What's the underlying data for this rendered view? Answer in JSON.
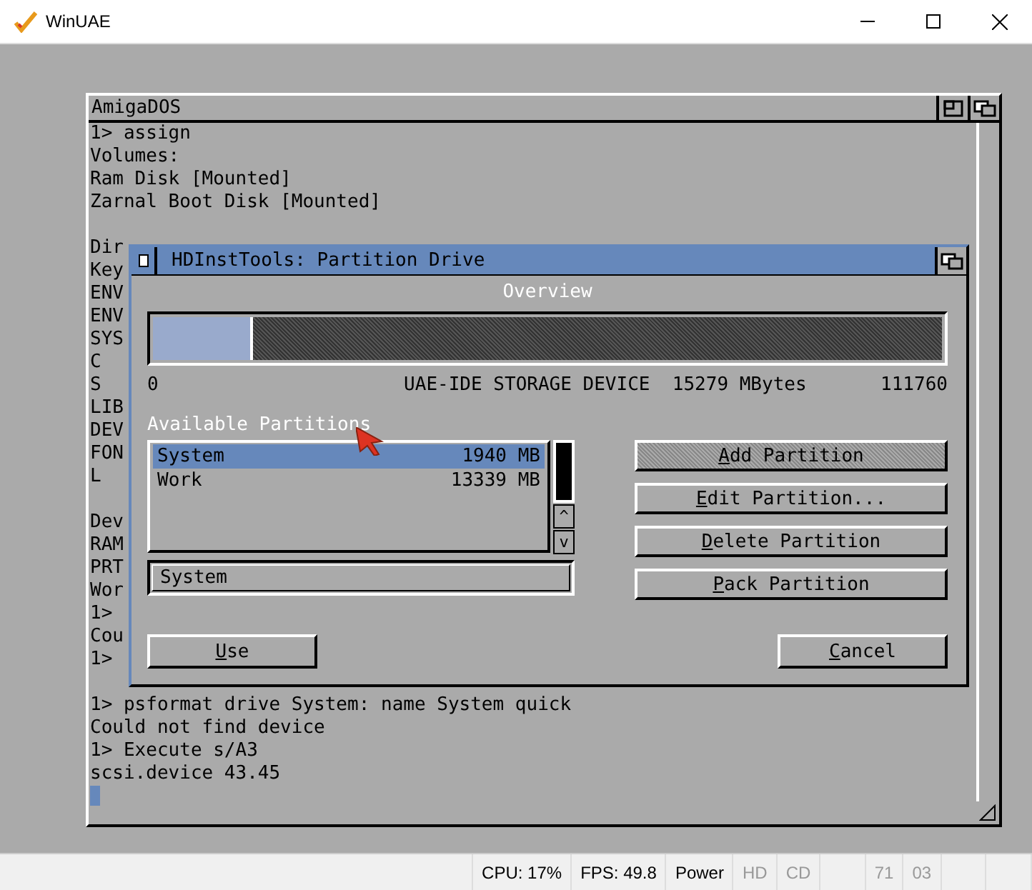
{
  "window": {
    "title": "WinUAE"
  },
  "console": {
    "title": "AmigaDOS",
    "groups": [
      [
        "1> assign",
        "Volumes:",
        "Ram Disk [Mounted]",
        "Zarnal Boot Disk [Mounted]"
      ],
      [
        "Dir",
        "Key",
        "ENV",
        "ENV",
        "SYS",
        "C",
        "S",
        "LIB",
        "DEV",
        "FON",
        "L"
      ],
      [
        "Dev",
        "RAM",
        "PRT",
        "Wor",
        "1>",
        "Cou",
        "1>"
      ],
      [
        "1> psformat drive System: name System quick",
        "Could not find device",
        "1> Execute s/A3",
        "scsi.device 43.45"
      ]
    ]
  },
  "dialog": {
    "title": "HDInstTools: Partition Drive",
    "overview_label": "Overview",
    "bar": {
      "level": 0.127
    },
    "scale": {
      "start": "0",
      "device": "UAE-IDE STORAGE DEVICE  15279 MBytes",
      "end": "111760"
    },
    "partitions_label": "Available Partitions",
    "partitions": [
      {
        "name": "System",
        "size": "1940 MB",
        "selected": true
      },
      {
        "name": "Work",
        "size": "13339 MB",
        "selected": false
      }
    ],
    "scroll_up": "^",
    "scroll_down": "v",
    "name_field": "System",
    "actions": [
      {
        "label": "Add Partition",
        "disabled": true
      },
      {
        "label": "Edit Partition...",
        "disabled": false
      },
      {
        "label": "Delete Partition",
        "disabled": false
      },
      {
        "label": "Pack Partition",
        "disabled": false
      }
    ],
    "buttons": [
      "Use",
      "Cancel"
    ]
  },
  "status_bar": [
    {
      "text": "CPU: 17%",
      "on": true
    },
    {
      "text": "FPS: 49.8",
      "on": true
    },
    {
      "text": "Power",
      "on": true
    },
    {
      "text": "HD",
      "on": false
    },
    {
      "text": "CD",
      "on": false
    },
    {
      "text": "71",
      "on": false
    },
    {
      "text": "03",
      "on": false
    }
  ]
}
